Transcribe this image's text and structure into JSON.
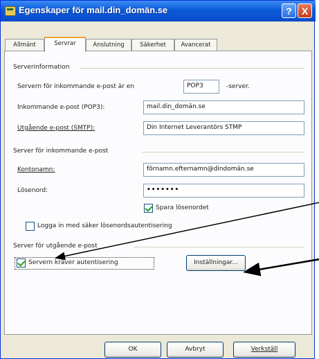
{
  "window": {
    "title": "Egenskaper för mail.din_domän.se",
    "help_symbol": "?",
    "close_symbol": "X"
  },
  "tabs": [
    {
      "label": "Allmänt",
      "active": false
    },
    {
      "label": "Servrar",
      "active": true
    },
    {
      "label": "Anslutning",
      "active": false
    },
    {
      "label": "Säkerhet",
      "active": false
    },
    {
      "label": "Avancerat",
      "active": false
    }
  ],
  "server_info": {
    "group_label": "Serverinformation",
    "incoming_type_label": "Servern för inkommande e-post är en",
    "incoming_type_value": "POP3",
    "incoming_type_suffix": "-server.",
    "incoming_label": "Inkommande e-post (POP3):",
    "incoming_value": "mail.din_domän.se",
    "outgoing_label": "Utgående e-post (SMTP):",
    "outgoing_value": "Din Internet Leverantörs STMP"
  },
  "incoming_server": {
    "group_label": "Server för inkommande e-post",
    "account_label": "Kontonamn:",
    "account_value": "förnamn.efternamn@dindomän.se",
    "password_label": "Lösenord:",
    "password_value": "•••••••",
    "remember_label": "Spara lösenordet",
    "remember_checked": true,
    "spa_label": "Logga in med säker lösenordsautentisering",
    "spa_checked": false
  },
  "outgoing_server": {
    "group_label": "Server för utgående e-post",
    "auth_label": "Servern kräver autentisering",
    "auth_checked": true,
    "settings_button": "Inställningar..."
  },
  "buttons": {
    "ok": "OK",
    "cancel": "Avbryt",
    "apply": "Verkställ"
  },
  "colors": {
    "titlebar": "#0a5ad8",
    "dialog_bg": "#ece9d8",
    "check_green": "#21a121"
  }
}
